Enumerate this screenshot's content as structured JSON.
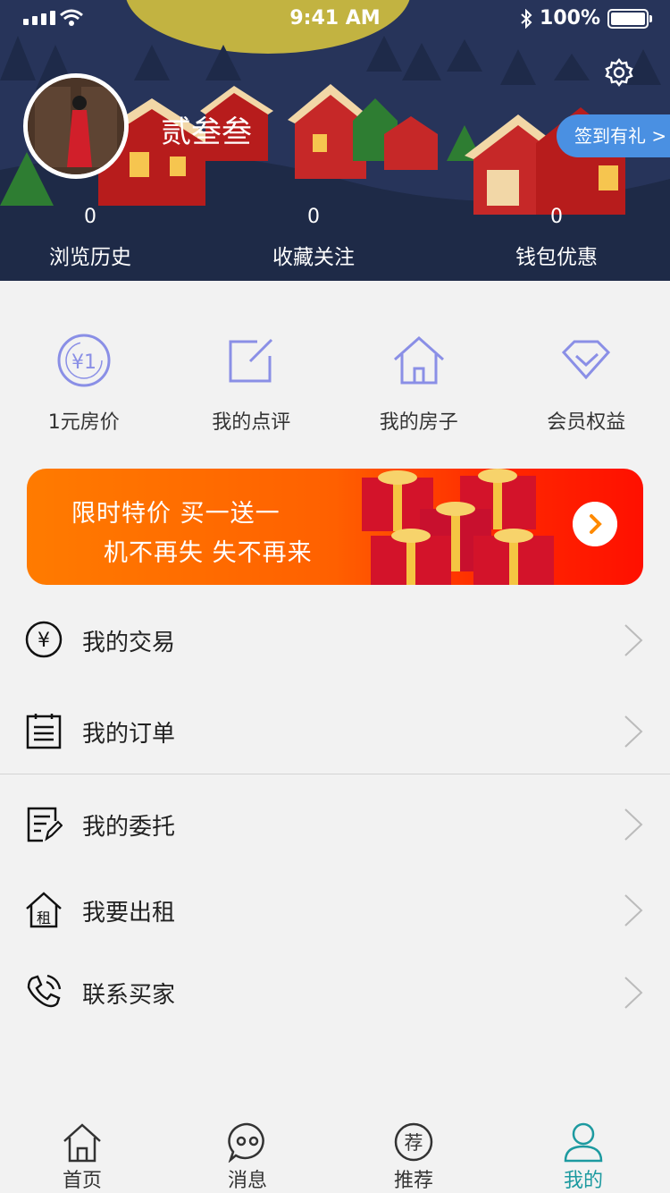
{
  "status_bar": {
    "time": "9:41 AM",
    "battery": "100%"
  },
  "profile": {
    "username": "贰叁叁",
    "signin_label": "签到有礼 >",
    "stats": [
      {
        "value": "0",
        "label": "浏览历史"
      },
      {
        "value": "0",
        "label": "收藏关注"
      },
      {
        "value": "0",
        "label": "钱包优惠"
      }
    ]
  },
  "quick_actions": [
    {
      "label": "1元房价",
      "icon": "yuan-coin-icon",
      "icon_text": "¥1"
    },
    {
      "label": "我的点评",
      "icon": "edit-icon"
    },
    {
      "label": "我的房子",
      "icon": "house-icon"
    },
    {
      "label": "会员权益",
      "icon": "diamond-icon"
    }
  ],
  "banner": {
    "line1": "限时特价 买一送一",
    "line2": "机不再失 失不再来"
  },
  "menu": [
    {
      "label": "我的交易",
      "icon": "yuan-circle-icon",
      "icon_text": "¥"
    },
    {
      "label": "我的订单",
      "icon": "order-list-icon"
    },
    {
      "label": "我的委托",
      "icon": "commission-doc-icon"
    },
    {
      "label": "我要出租",
      "icon": "rent-house-icon",
      "icon_text": "租"
    },
    {
      "label": "联系买家",
      "icon": "phone-call-icon"
    }
  ],
  "tabs": [
    {
      "label": "首页",
      "icon": "home-icon"
    },
    {
      "label": "消息",
      "icon": "message-icon"
    },
    {
      "label": "推荐",
      "icon": "recommend-icon",
      "icon_text": "荐"
    },
    {
      "label": "我的",
      "icon": "profile-icon",
      "active": true
    }
  ],
  "colors": {
    "accent": "#1d9aa0",
    "icon_purple": "#8a8fe6",
    "signin_blue": "#4a90e2",
    "banner_orange": "#ff7b00",
    "banner_red": "#ff1000"
  }
}
